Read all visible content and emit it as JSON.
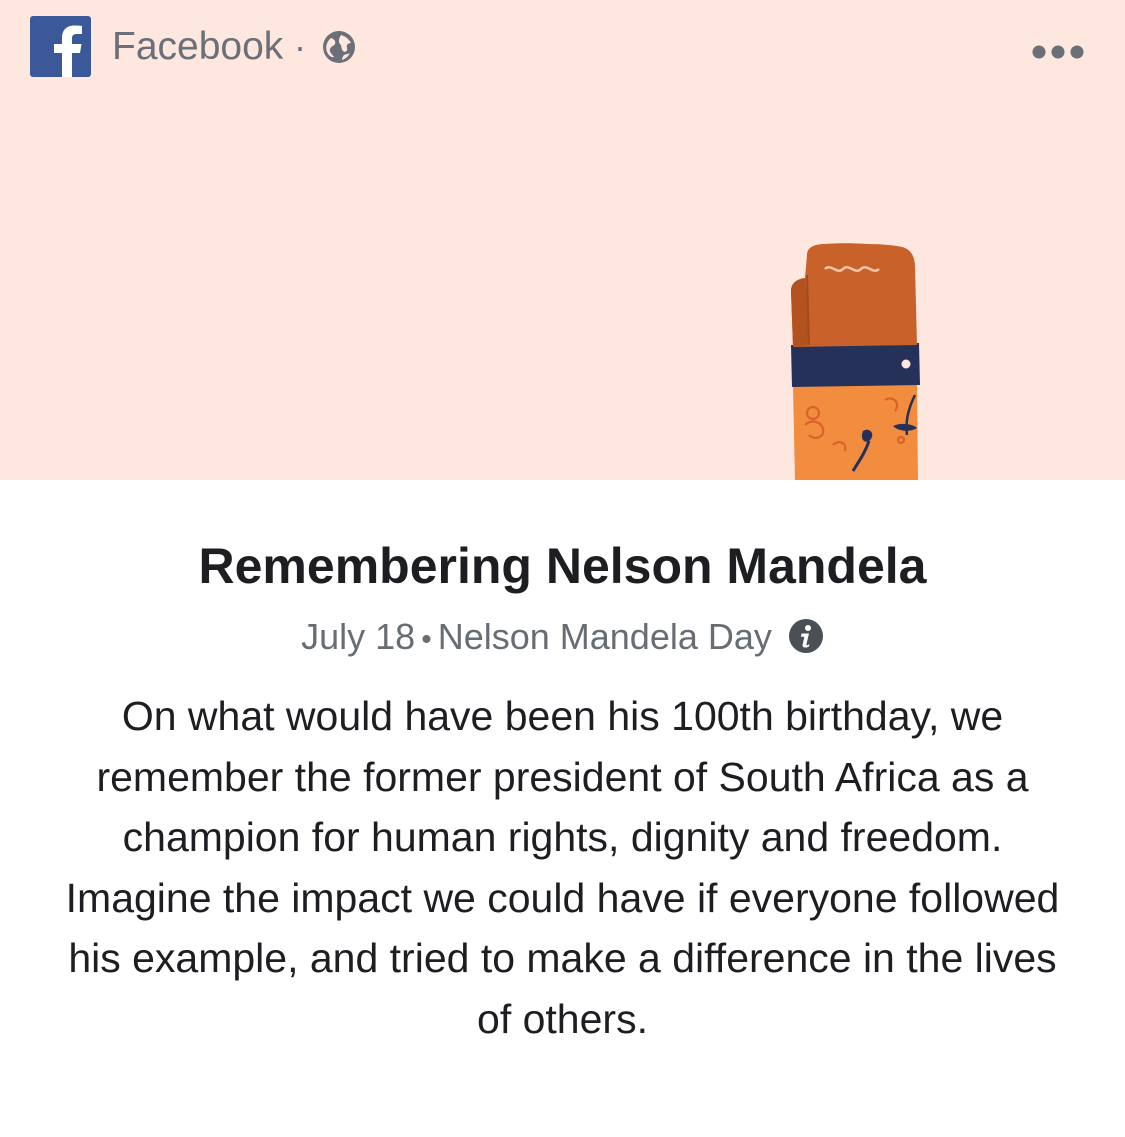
{
  "header": {
    "source_name": "Facebook",
    "separator": "·",
    "logo_icon": "facebook-f-icon",
    "privacy_icon": "globe-icon",
    "more_icon": "more-dots-icon"
  },
  "banner": {
    "background_color": "#fde7df",
    "illustration": "raised-fist-illustration"
  },
  "post": {
    "title": "Remembering Nelson Mandela",
    "date": "July 18",
    "bullet": "•",
    "event": "Nelson Mandela Day",
    "info_icon": "info-icon",
    "body": "On what would have been his 100th birthday, we remember the former president of South Africa as a champion for human rights, dignity and freedom. Imagine the impact we could have if everyone followed his example, and tried to make a difference in the lives of others."
  },
  "colors": {
    "brand": "#3b5998",
    "text_primary": "#1c1e21",
    "text_secondary": "#686c73"
  }
}
